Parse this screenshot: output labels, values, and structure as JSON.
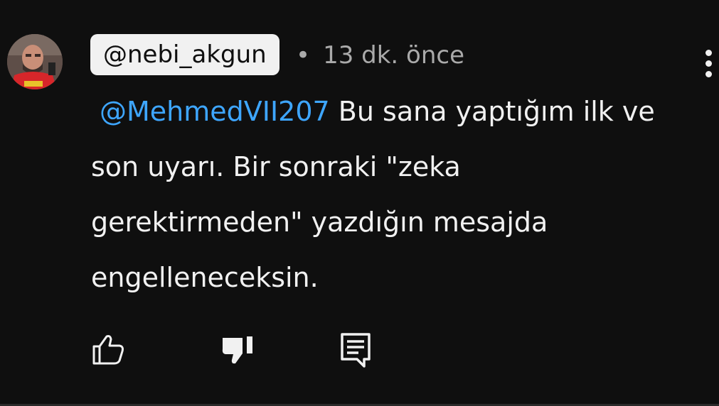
{
  "comment": {
    "author": "@nebi_akgun",
    "separator": "•",
    "timestamp": "13 dk. önce",
    "mention": "@MehmedVII207",
    "text": " Bu sana yaptığım ilk ve son uyarı. Bir sonraki \"zeka gerektirmeden\" yazdığın mesajda engelleneceksin.",
    "actions": {
      "like_icon": "thumb-up-outline-icon",
      "dislike_icon": "thumb-down-filled-icon",
      "reply_icon": "comment-reply-icon",
      "menu_icon": "more-vertical-icon"
    }
  },
  "colors": {
    "background": "#0f0f0f",
    "text": "#f1f1f1",
    "muted": "#aaaaaa",
    "mention": "#3ea6ff",
    "author_chip": "#f1f1f1"
  }
}
